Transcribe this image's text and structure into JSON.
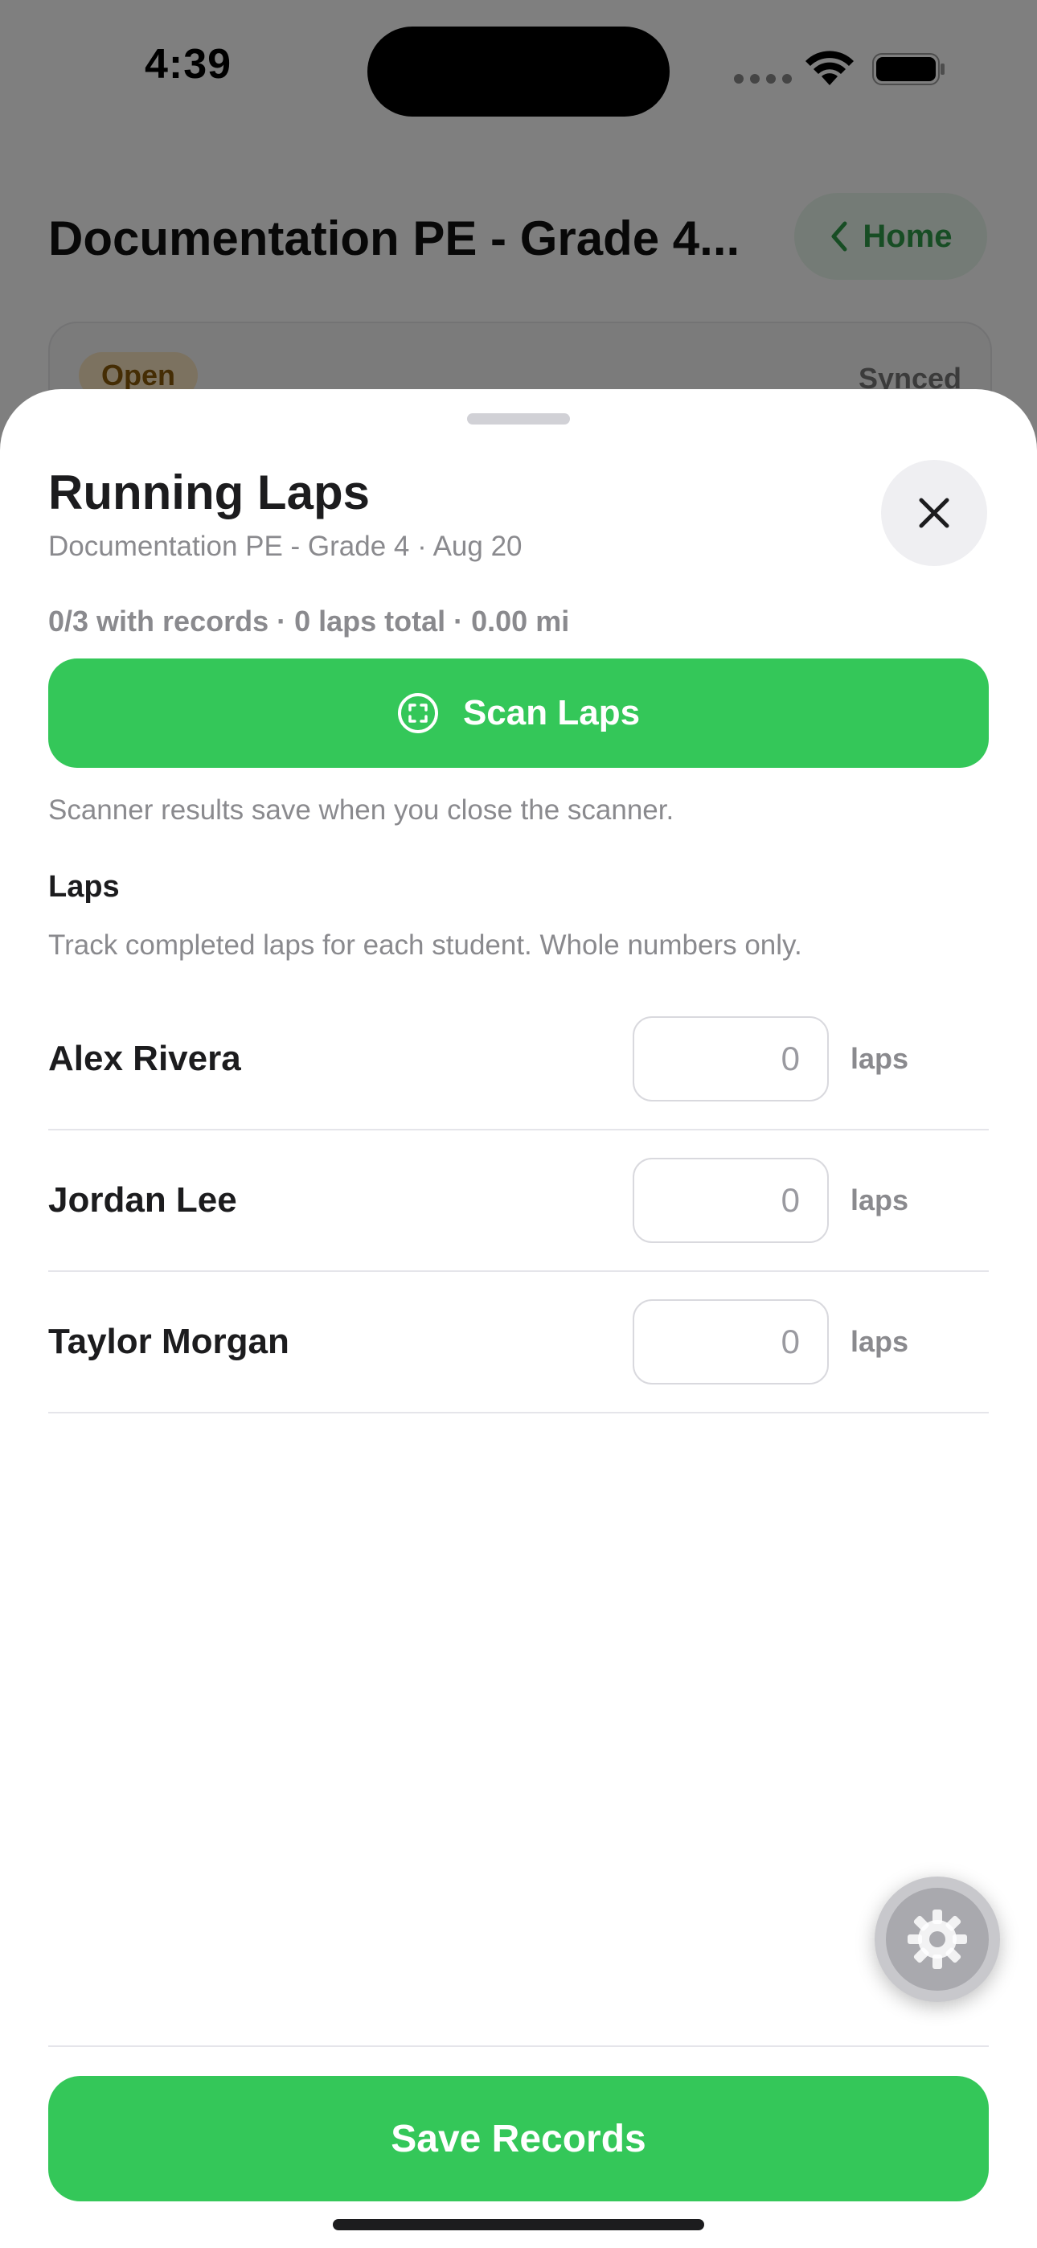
{
  "status_bar": {
    "time": "4:39"
  },
  "background": {
    "title": "Documentation PE - Grade 4...",
    "home_button": "Home",
    "badge": "Open",
    "sync_status": "Synced"
  },
  "sheet": {
    "title": "Running Laps",
    "subtitle": "Documentation PE - Grade 4 · Aug 20",
    "summary": "0/3 with records · 0 laps total · 0.00 mi",
    "scan_button": "Scan Laps",
    "scanner_note": "Scanner results save when you close the scanner.",
    "section_title": "Laps",
    "section_description": "Track completed laps for each student. Whole numbers only.",
    "students": [
      {
        "name": "Alex Rivera",
        "placeholder": "0",
        "unit": "laps"
      },
      {
        "name": "Jordan Lee",
        "placeholder": "0",
        "unit": "laps"
      },
      {
        "name": "Taylor Morgan",
        "placeholder": "0",
        "unit": "laps"
      }
    ],
    "save_button": "Save Records"
  },
  "colors": {
    "accent_green": "#34c759",
    "secondary_text": "#8a8a8e",
    "home_button_text": "#2f9a48"
  },
  "icons": {
    "close": "close-icon",
    "scan": "scan-icon",
    "settings": "gear-icon",
    "back": "chevron-left-icon"
  }
}
